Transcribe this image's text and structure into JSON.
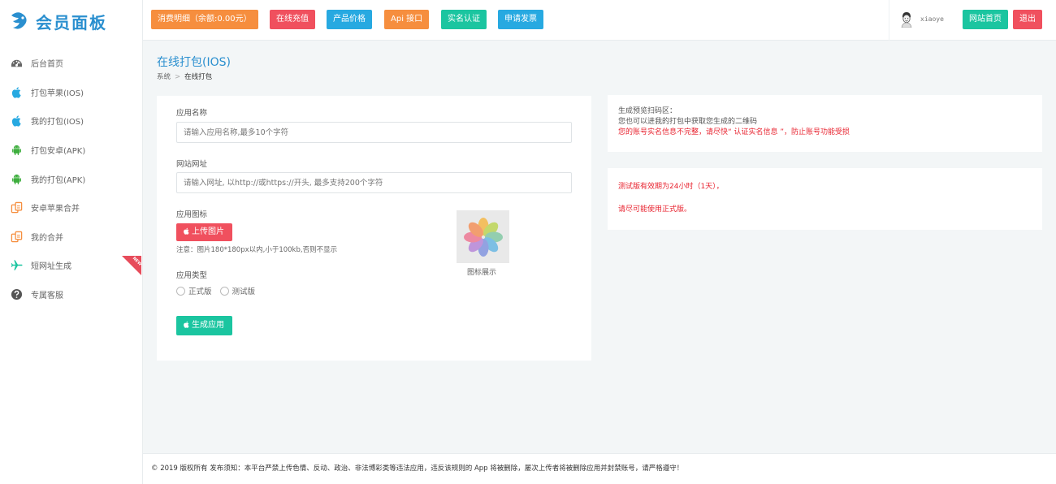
{
  "logo": {
    "text": "会员面板"
  },
  "sidebar": {
    "items": [
      {
        "label": "后台首页",
        "icon": "dashboard-icon"
      },
      {
        "label": "打包苹果(IOS)",
        "icon": "apple-icon"
      },
      {
        "label": "我的打包(IOS)",
        "icon": "apple-icon"
      },
      {
        "label": "打包安卓(APK)",
        "icon": "android-icon"
      },
      {
        "label": "我的打包(APK)",
        "icon": "android-icon"
      },
      {
        "label": "安卓苹果合并",
        "icon": "merge-icon"
      },
      {
        "label": "我的合并",
        "icon": "merge-icon"
      },
      {
        "label": "短网址生成",
        "icon": "plane-icon",
        "badge": "NEW"
      },
      {
        "label": "专属客服",
        "icon": "help-icon"
      }
    ]
  },
  "header": {
    "buttons": [
      {
        "label": "消费明细（余额:0.00元）",
        "color": "#f68e3e"
      },
      {
        "label": "在线充值",
        "color": "#f0505e"
      },
      {
        "label": "产品价格",
        "color": "#27a9e1"
      },
      {
        "label": "Api 接口",
        "color": "#f68e3e"
      },
      {
        "label": "实名认证",
        "color": "#1bc5a0"
      },
      {
        "label": "申请发票",
        "color": "#27a9e1"
      }
    ],
    "username": "xiaoye",
    "home_button": "网站首页",
    "logout_button": "退出"
  },
  "page": {
    "title": "在线打包(IOS)",
    "breadcrumb": [
      "系统",
      "在线打包"
    ]
  },
  "form": {
    "app_name_label": "应用名称",
    "app_name_placeholder": "请输入应用名称,最多10个字符",
    "url_label": "网站网址",
    "url_placeholder": "请输入网址, 以http://或https://开头, 最多支持200个字符",
    "icon_label": "应用图标",
    "upload_button": "上传图片",
    "upload_note": "注意：图片180*180px以内,小于100kb,否则不显示",
    "icon_caption": "图标展示",
    "type_label": "应用类型",
    "type_options": [
      "正式版",
      "测试版"
    ],
    "generate_button": "生成应用"
  },
  "qr_panel": {
    "line1": "生成预览扫码区：",
    "line2": "您也可以进我的打包中获取您生成的二维码",
    "warning": "您的账号实名信息不完整，请尽快“ 认证实名信息 ”，防止账号功能受损"
  },
  "test_panel": {
    "line1": "测试版有效期为24小时（1天），",
    "line2": "请尽可能使用正式版。"
  },
  "footer": {
    "text": "© 2019 版权所有 发布须知：本平台严禁上传色情、反动、政治、非法博彩类等违法应用，违反该规则的 App 将被删除，屡次上传者将被删除应用并封禁账号，请严格遵守！"
  }
}
